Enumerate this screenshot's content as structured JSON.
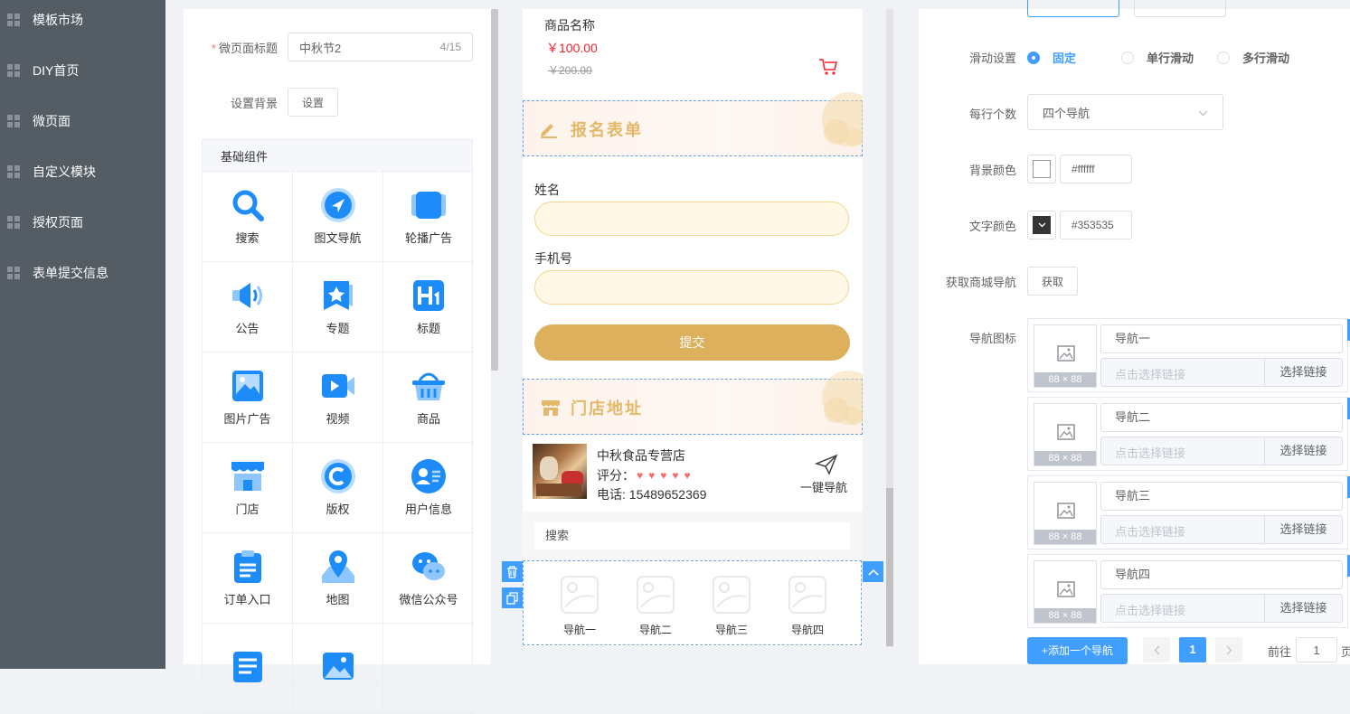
{
  "sidebar": {
    "items": [
      {
        "label": "模板市场"
      },
      {
        "label": "DIY首页"
      },
      {
        "label": "微页面"
      },
      {
        "label": "自定义模块"
      },
      {
        "label": "授权页面"
      },
      {
        "label": "表单提交信息"
      }
    ]
  },
  "settings": {
    "title_label": "微页面标题",
    "title_required_mark": "*",
    "title_value": "中秋节2",
    "title_count": "4/15",
    "bg_label": "设置背景",
    "bg_button": "设置"
  },
  "components": {
    "heading": "基础组件",
    "items": [
      {
        "label": "搜索",
        "icon": "search-icon"
      },
      {
        "label": "图文导航",
        "icon": "navigation-icon"
      },
      {
        "label": "轮播广告",
        "icon": "carousel-icon"
      },
      {
        "label": "公告",
        "icon": "speaker-icon"
      },
      {
        "label": "专题",
        "icon": "topic-star-icon"
      },
      {
        "label": "标题",
        "icon": "heading-icon"
      },
      {
        "label": "图片广告",
        "icon": "image-icon"
      },
      {
        "label": "视频",
        "icon": "video-icon"
      },
      {
        "label": "商品",
        "icon": "basket-icon"
      },
      {
        "label": "门店",
        "icon": "store-icon"
      },
      {
        "label": "版权",
        "icon": "copyright-icon"
      },
      {
        "label": "用户信息",
        "icon": "user-card-icon"
      },
      {
        "label": "订单入口",
        "icon": "clipboard-icon"
      },
      {
        "label": "地图",
        "icon": "map-pin-icon"
      },
      {
        "label": "微信公众号",
        "icon": "wechat-icon"
      },
      {
        "label": "",
        "icon": "document-icon"
      },
      {
        "label": "",
        "icon": "picture-icon"
      },
      {
        "label": "",
        "icon": ""
      }
    ]
  },
  "preview": {
    "product": {
      "name": "商品名称",
      "price": "￥100.00",
      "old_price": "￥200.00"
    },
    "form_banner": "报名表单",
    "form_fields": [
      {
        "label": "姓名"
      },
      {
        "label": "手机号"
      }
    ],
    "submit": "提交",
    "store_banner": "门店地址",
    "store": {
      "name": "中秋食品专营店",
      "rating_label": "评分：",
      "rating": 5,
      "phone": "电话: 15489652369",
      "nav_label": "一键导航"
    },
    "search_placeholder": "搜索",
    "nav_items": [
      {
        "label": "导航一"
      },
      {
        "label": "导航二"
      },
      {
        "label": "导航三"
      },
      {
        "label": "导航四"
      }
    ]
  },
  "props": {
    "scroll_label": "滑动设置",
    "scroll_options": [
      {
        "label": "固定",
        "selected": true
      },
      {
        "label": "单行滑动",
        "selected": false
      },
      {
        "label": "多行滑动",
        "selected": false
      }
    ],
    "per_row_label": "每行个数",
    "per_row_value": "四个导航",
    "bg_color_label": "背景颜色",
    "bg_color_value": "#ffffff",
    "text_color_label": "文字颜色",
    "text_color_value": "#353535",
    "fetch_label": "获取商城导航",
    "fetch_button": "获取",
    "icon_label": "导航图标",
    "nav_entries": [
      {
        "name": "导航一",
        "size": "88 × 88",
        "link_placeholder": "点击选择链接",
        "select": "选择链接"
      },
      {
        "name": "导航二",
        "size": "88 × 88",
        "link_placeholder": "点击选择链接",
        "select": "选择链接"
      },
      {
        "name": "导航三",
        "size": "88 × 88",
        "link_placeholder": "点击选择链接",
        "select": "选择链接"
      },
      {
        "name": "导航四",
        "size": "88 × 88",
        "link_placeholder": "点击选择链接",
        "select": "选择链接"
      }
    ],
    "add_button": "+添加一个导航",
    "pagination": {
      "current": "1",
      "goto_label": "前往",
      "goto_value": "1",
      "page_suffix": "页"
    }
  },
  "colors": {
    "accent": "#409eff",
    "price": "#f5222d",
    "gold": "#e3b868",
    "sidebar": "#545c64"
  }
}
